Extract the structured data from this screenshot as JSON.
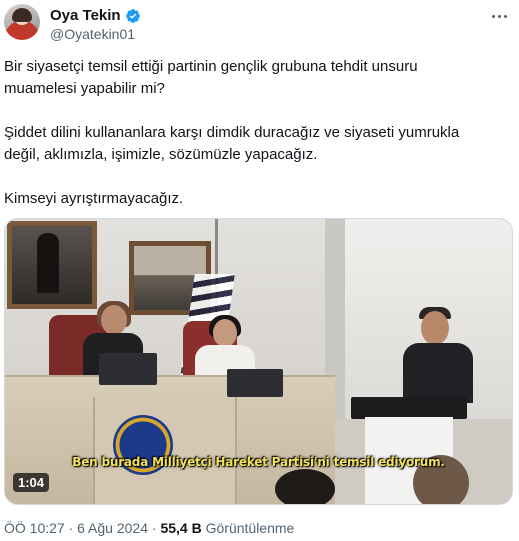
{
  "author": {
    "display_name": "Oya Tekin",
    "handle": "@Oyatekin01",
    "verified": true,
    "badge_color": "#1d9bf0"
  },
  "tweet": {
    "paragraph_1": "Bir siyasetçi temsil ettiği partinin gençlik grubuna tehdit unsuru muamelesi yapabilir mi?",
    "paragraph_2": "Şiddet dilini kullananlara karşı dimdik duracağız ve siyaseti yumrukla değil, aklımızla, işimizle, sözümüzle yapacağız.",
    "paragraph_3": "Kimseyi ayrıştırmayacağız."
  },
  "video": {
    "subtitle": "Ben burada Milliyetçi Hareket Partisi'ni temsil ediyorum.",
    "duration": "1:04"
  },
  "meta": {
    "time": "ÖÖ 10:27",
    "separator_1": "·",
    "date": "6 Ağu 2024",
    "separator_2": "·",
    "views_count": "55,4 B",
    "views_label": "Görüntülenme"
  },
  "icons": {
    "more": "more-options-icon",
    "verified": "verified-badge-icon"
  }
}
